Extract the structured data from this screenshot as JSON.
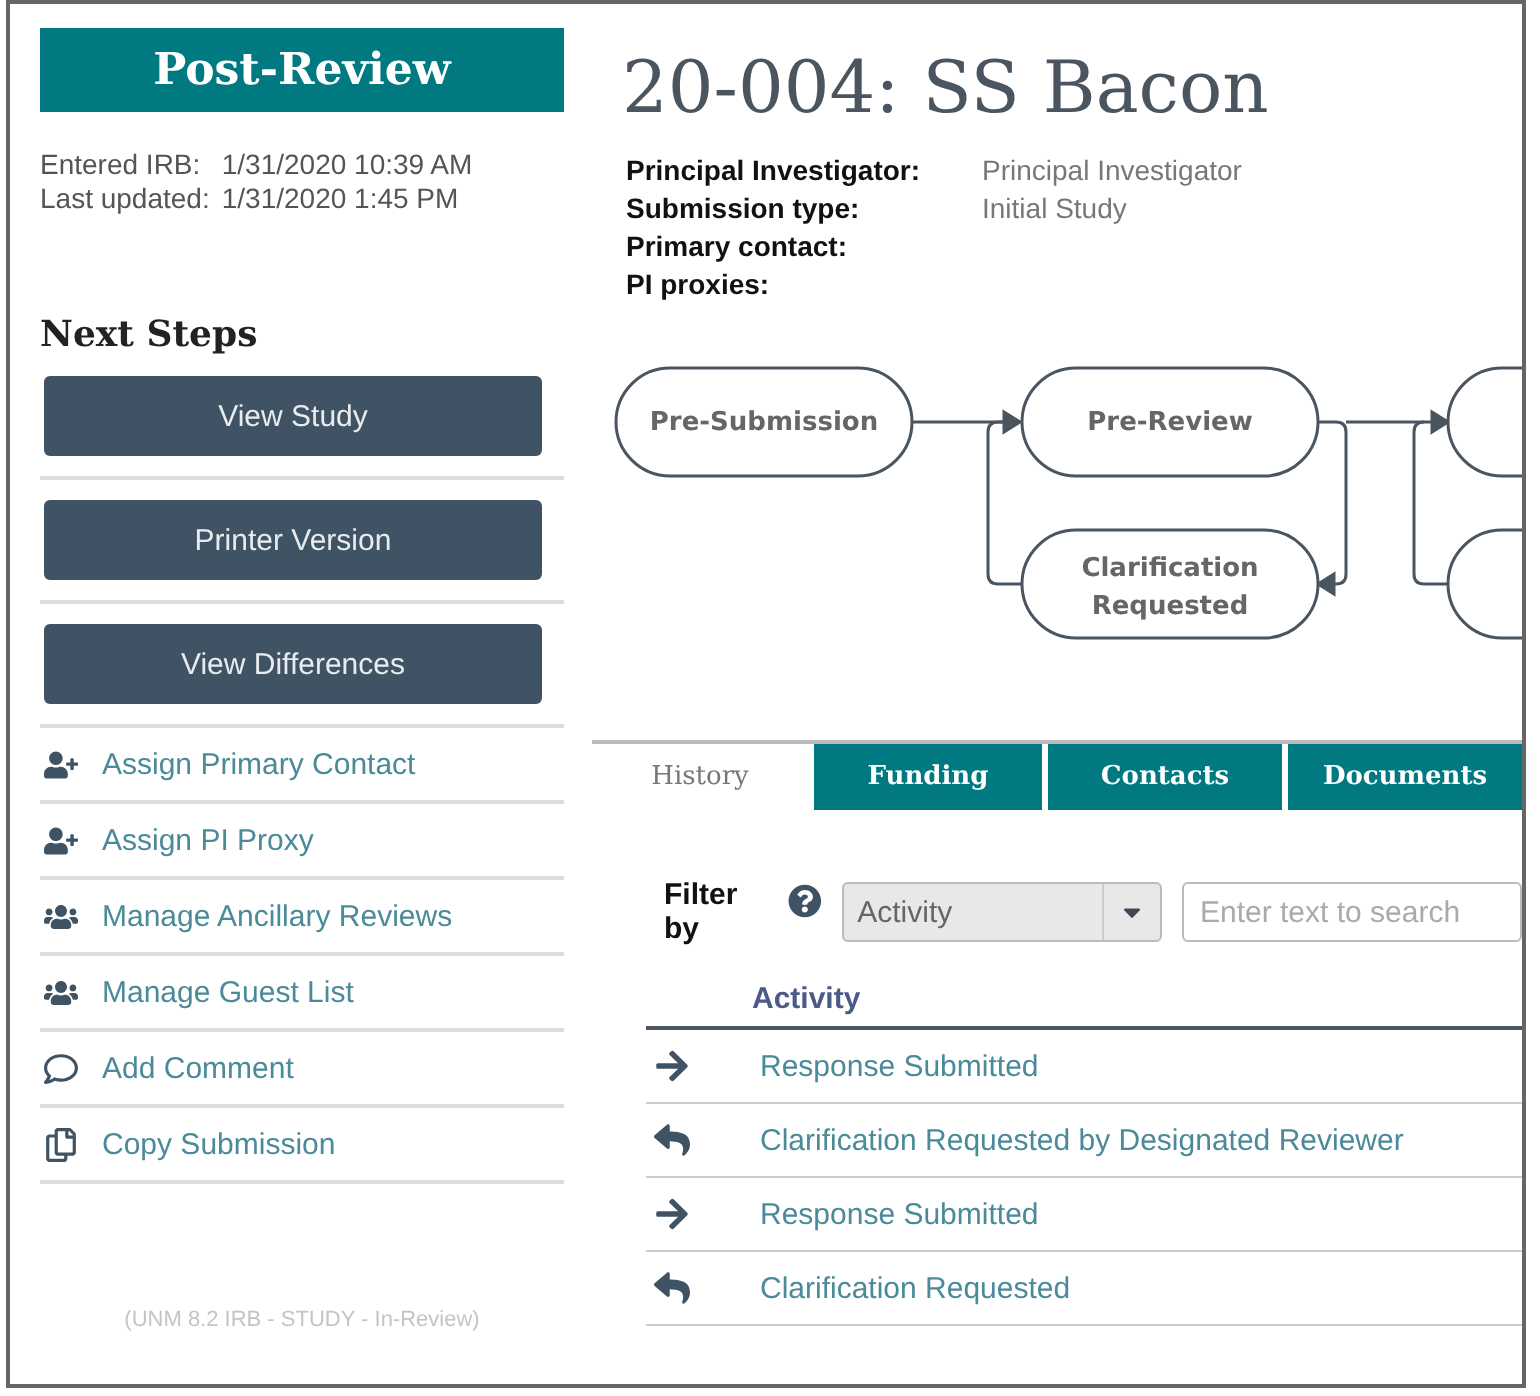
{
  "status_banner": "Post-Review",
  "dates": [
    {
      "label": "Entered IRB:",
      "value": "1/31/2020 10:39 AM"
    },
    {
      "label": "Last updated:",
      "value": "1/31/2020 1:45 PM"
    }
  ],
  "next_steps": {
    "heading": "Next Steps",
    "buttons": [
      "View Study",
      "Printer Version",
      "View Differences"
    ],
    "actions": [
      {
        "kind": "add-person",
        "label": "Assign Primary Contact"
      },
      {
        "kind": "add-person",
        "label": "Assign PI Proxy"
      },
      {
        "kind": "group",
        "label": "Manage Ancillary Reviews"
      },
      {
        "kind": "group",
        "label": "Manage Guest List"
      },
      {
        "kind": "comment",
        "label": "Add Comment"
      },
      {
        "kind": "copy",
        "label": "Copy Submission"
      }
    ]
  },
  "footer": "(UNM 8.2 IRB - STUDY - In-Review)",
  "study": {
    "title": "20-004: SS Bacon",
    "fields": [
      {
        "label": "Principal Investigator:",
        "value": "Principal Investigator"
      },
      {
        "label": "Submission type:",
        "value": "Initial Study"
      },
      {
        "label": "Primary contact:"
      },
      {
        "label": "PI proxies:"
      }
    ]
  },
  "workflow": {
    "nodes": [
      {
        "label": "Pre-Submission"
      },
      {
        "label": "Pre-Review"
      },
      {
        "label": "Clarification Requested"
      }
    ]
  },
  "tabs": [
    {
      "label": "History",
      "selected": true
    },
    {
      "label": "Funding",
      "selected": false
    },
    {
      "label": "Contacts",
      "selected": false
    },
    {
      "label": "Documents",
      "selected": false
    }
  ],
  "filter": {
    "label": "Filter by",
    "select_value": "Activity",
    "search_placeholder": "Enter text to search"
  },
  "history": {
    "columns": [
      "Activity"
    ],
    "rows": [
      {
        "kind": "forward",
        "activity": "Response Submitted"
      },
      {
        "kind": "reply",
        "activity": "Clarification Requested by Designated Reviewer"
      },
      {
        "kind": "forward",
        "activity": "Response Submitted"
      },
      {
        "kind": "reply",
        "activity": "Clarification Requested"
      }
    ]
  }
}
